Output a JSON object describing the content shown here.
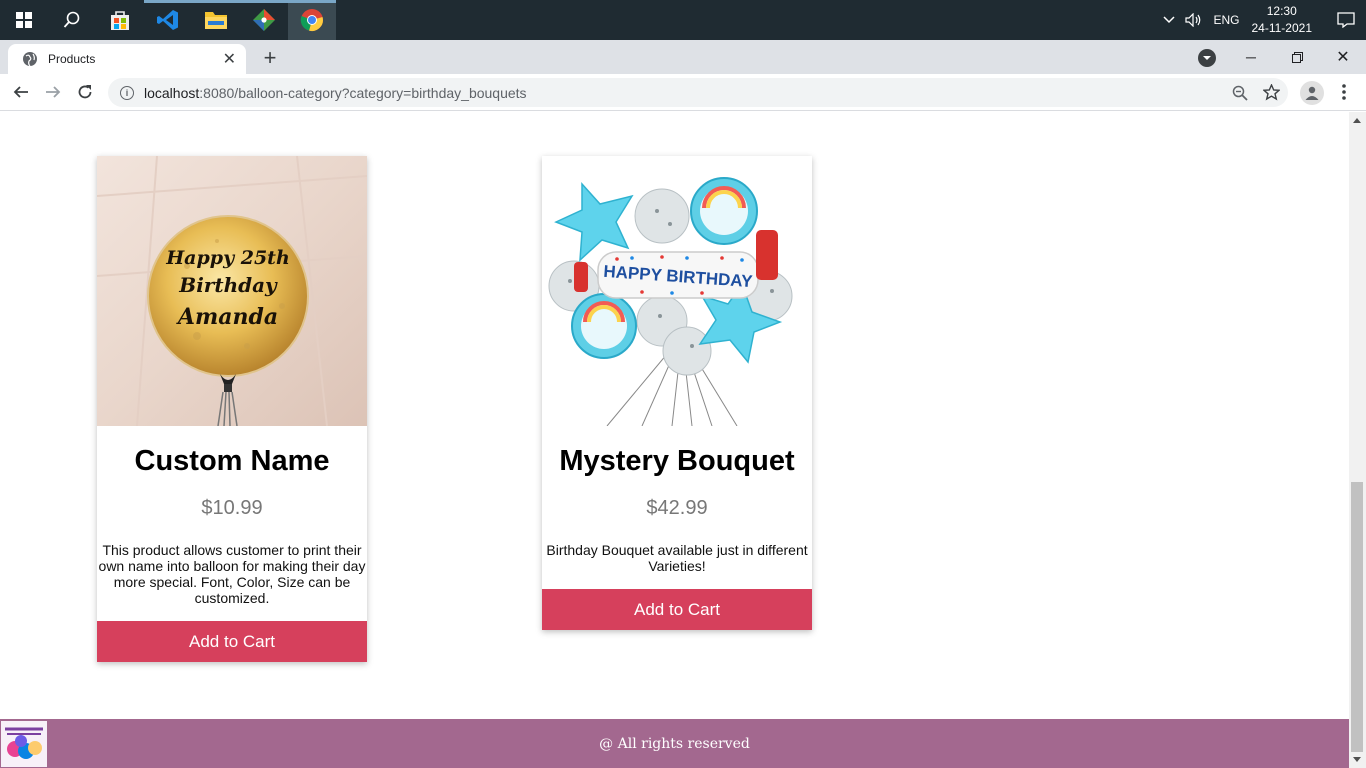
{
  "browser": {
    "tab_title": "Products",
    "url_host": "localhost",
    "url_rest": ":8080/balloon-category?category=birthday_bouquets"
  },
  "taskbar": {
    "language": "ENG",
    "time": "12:30",
    "date": "24-11-2021"
  },
  "products": [
    {
      "name": "Custom Name",
      "price": "$10.99",
      "description": "This product allows customer to print their own name into balloon for making their day more special. Font, Color, Size can be customized.",
      "button": "Add to Cart",
      "image_text": [
        "Happy 25th",
        "Birthday",
        "Amanda"
      ]
    },
    {
      "name": "Mystery Bouquet",
      "price": "$42.99",
      "description": "Birthday Bouquet available just in different Varieties!",
      "button": "Add to Cart",
      "image_text": [
        "HAPPY BIRTHDAY"
      ]
    }
  ],
  "footer": {
    "text": "@ All rights reserved"
  },
  "colors": {
    "accent": "#d6405c",
    "footer": "#a3688f",
    "taskbar": "#1f2b32"
  }
}
